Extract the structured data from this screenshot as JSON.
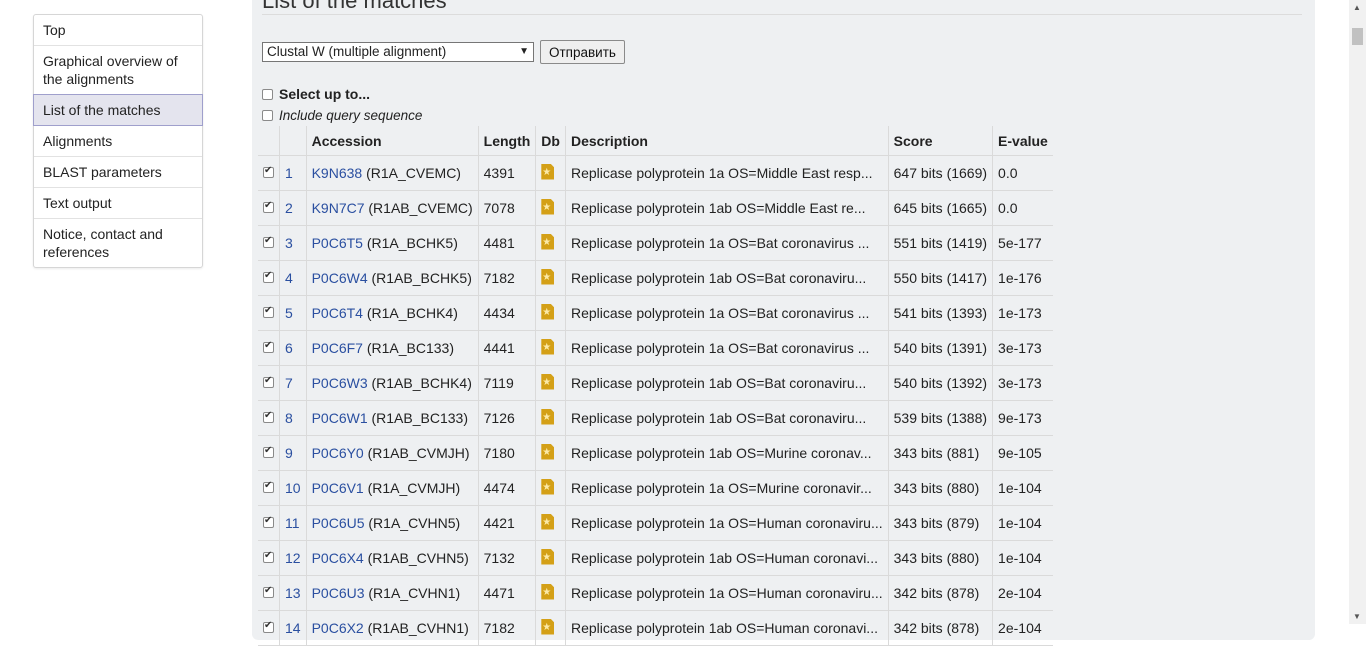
{
  "sidebar": {
    "items": [
      {
        "label": "Top"
      },
      {
        "label": "Graphical overview of the alignments"
      },
      {
        "label": "List of the matches"
      },
      {
        "label": "Alignments"
      },
      {
        "label": "BLAST parameters"
      },
      {
        "label": "Text output"
      },
      {
        "label": "Notice, contact and references"
      }
    ]
  },
  "main": {
    "title": "List of the matches",
    "select_value": "Clustal W (multiple alignment)",
    "submit_label": "Отправить",
    "select_up_to": "Select up to...",
    "include_query": "Include query sequence"
  },
  "table": {
    "headers": {
      "accession": "Accession",
      "length": "Length",
      "db": "Db",
      "description": "Description",
      "score": "Score",
      "evalue": "E-value"
    },
    "rows": [
      {
        "rank": "1",
        "acc": "K9N638",
        "id": "(R1A_CVEMC)",
        "length": "4391",
        "desc": "Replicase polyprotein 1a OS=Middle East resp...",
        "score": "647 bits (1669)",
        "evalue": "0.0"
      },
      {
        "rank": "2",
        "acc": "K9N7C7",
        "id": "(R1AB_CVEMC)",
        "length": "7078",
        "desc": "Replicase polyprotein 1ab OS=Middle East re...",
        "score": "645 bits (1665)",
        "evalue": "0.0"
      },
      {
        "rank": "3",
        "acc": "P0C6T5",
        "id": "(R1A_BCHK5)",
        "length": "4481",
        "desc": "Replicase polyprotein 1a OS=Bat coronavirus ...",
        "score": "551 bits (1419)",
        "evalue": "5e-177"
      },
      {
        "rank": "4",
        "acc": "P0C6W4",
        "id": "(R1AB_BCHK5)",
        "length": "7182",
        "desc": "Replicase polyprotein 1ab OS=Bat coronaviru...",
        "score": "550 bits (1417)",
        "evalue": "1e-176"
      },
      {
        "rank": "5",
        "acc": "P0C6T4",
        "id": "(R1A_BCHK4)",
        "length": "4434",
        "desc": "Replicase polyprotein 1a OS=Bat coronavirus ...",
        "score": "541 bits (1393)",
        "evalue": "1e-173"
      },
      {
        "rank": "6",
        "acc": "P0C6F7",
        "id": "(R1A_BC133)",
        "length": "4441",
        "desc": "Replicase polyprotein 1a OS=Bat coronavirus ...",
        "score": "540 bits (1391)",
        "evalue": "3e-173"
      },
      {
        "rank": "7",
        "acc": "P0C6W3",
        "id": "(R1AB_BCHK4)",
        "length": "7119",
        "desc": "Replicase polyprotein 1ab OS=Bat coronaviru...",
        "score": "540 bits (1392)",
        "evalue": "3e-173"
      },
      {
        "rank": "8",
        "acc": "P0C6W1",
        "id": "(R1AB_BC133)",
        "length": "7126",
        "desc": "Replicase polyprotein 1ab OS=Bat coronaviru...",
        "score": "539 bits (1388)",
        "evalue": "9e-173"
      },
      {
        "rank": "9",
        "acc": "P0C6Y0",
        "id": "(R1AB_CVMJH)",
        "length": "7180",
        "desc": "Replicase polyprotein 1ab OS=Murine coronav...",
        "score": "343 bits (881)",
        "evalue": "9e-105"
      },
      {
        "rank": "10",
        "acc": "P0C6V1",
        "id": "(R1A_CVMJH)",
        "length": "4474",
        "desc": "Replicase polyprotein 1a OS=Murine coronavir...",
        "score": "343 bits (880)",
        "evalue": "1e-104"
      },
      {
        "rank": "11",
        "acc": "P0C6U5",
        "id": "(R1A_CVHN5)",
        "length": "4421",
        "desc": "Replicase polyprotein 1a OS=Human coronaviru...",
        "score": "343 bits (879)",
        "evalue": "1e-104"
      },
      {
        "rank": "12",
        "acc": "P0C6X4",
        "id": "(R1AB_CVHN5)",
        "length": "7132",
        "desc": "Replicase polyprotein 1ab OS=Human coronavi...",
        "score": "343 bits (880)",
        "evalue": "1e-104"
      },
      {
        "rank": "13",
        "acc": "P0C6U3",
        "id": "(R1A_CVHN1)",
        "length": "4471",
        "desc": "Replicase polyprotein 1a OS=Human coronaviru...",
        "score": "342 bits (878)",
        "evalue": "2e-104"
      },
      {
        "rank": "14",
        "acc": "P0C6X2",
        "id": "(R1AB_CVHN1)",
        "length": "7182",
        "desc": "Replicase polyprotein 1ab OS=Human coronavi...",
        "score": "342 bits (878)",
        "evalue": "2e-104"
      }
    ]
  },
  "icons": {
    "db": "uniprot-doc-icon",
    "checkbox": "checkbox-icon"
  },
  "colors": {
    "link": "#2a4fa0",
    "db_icon": "#d4a017",
    "active_nav": "#e4e4ee",
    "panel": "#eef0f2"
  }
}
